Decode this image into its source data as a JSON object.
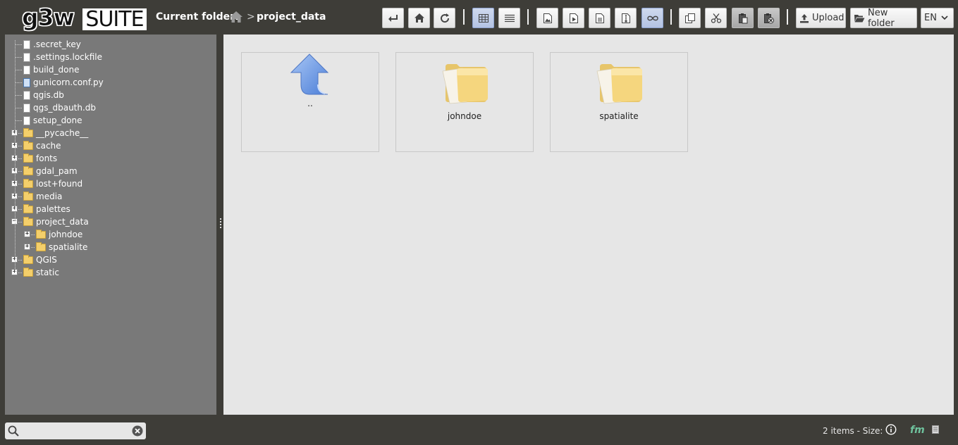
{
  "header": {
    "logo_left": "g3w",
    "logo_right": "SUITE",
    "current_folder_label": "Current folder:",
    "breadcrumb_separator": ">",
    "breadcrumb_current": "project_data"
  },
  "toolbar": {
    "upload_label": "Upload",
    "new_folder_label": "New folder",
    "language": "EN",
    "buttons": [
      "back-icon",
      "home-icon",
      "refresh-icon",
      "grid-view-icon",
      "list-view-icon",
      "image-filter-icon",
      "video-filter-icon",
      "document-filter-icon",
      "archive-filter-icon",
      "all-filter-icon",
      "copy-icon",
      "cut-icon",
      "paste-icon",
      "clear-clipboard-icon"
    ]
  },
  "tree": {
    "files": [
      ".secret_key",
      ".settings.lockfile",
      "build_done",
      "gunicorn.conf.py",
      "qgis.db",
      "qgs_dbauth.db",
      "setup_done"
    ],
    "folders": [
      "__pycache__",
      "cache",
      "fonts",
      "gdal_pam",
      "lost+found",
      "media",
      "palettes",
      "project_data"
    ],
    "subfolders": [
      "johndoe",
      "spatialite"
    ],
    "folders_after": [
      "QGIS",
      "static"
    ]
  },
  "main": {
    "tiles": [
      {
        "label": "..",
        "type": "parent-folder"
      },
      {
        "label": "johndoe",
        "type": "folder"
      },
      {
        "label": "spatialite",
        "type": "folder"
      }
    ]
  },
  "footer": {
    "search_placeholder": "",
    "status": "2 items - Size:",
    "brand": "fm"
  },
  "colors": {
    "background": "#3e3d38",
    "sidebar": "#797979",
    "main_panel": "#e6e6e6",
    "active_button": "#b4c3e3",
    "folder": "#f4cf6b",
    "up_arrow": "#6f9be6",
    "brand": "#6fc39e"
  }
}
